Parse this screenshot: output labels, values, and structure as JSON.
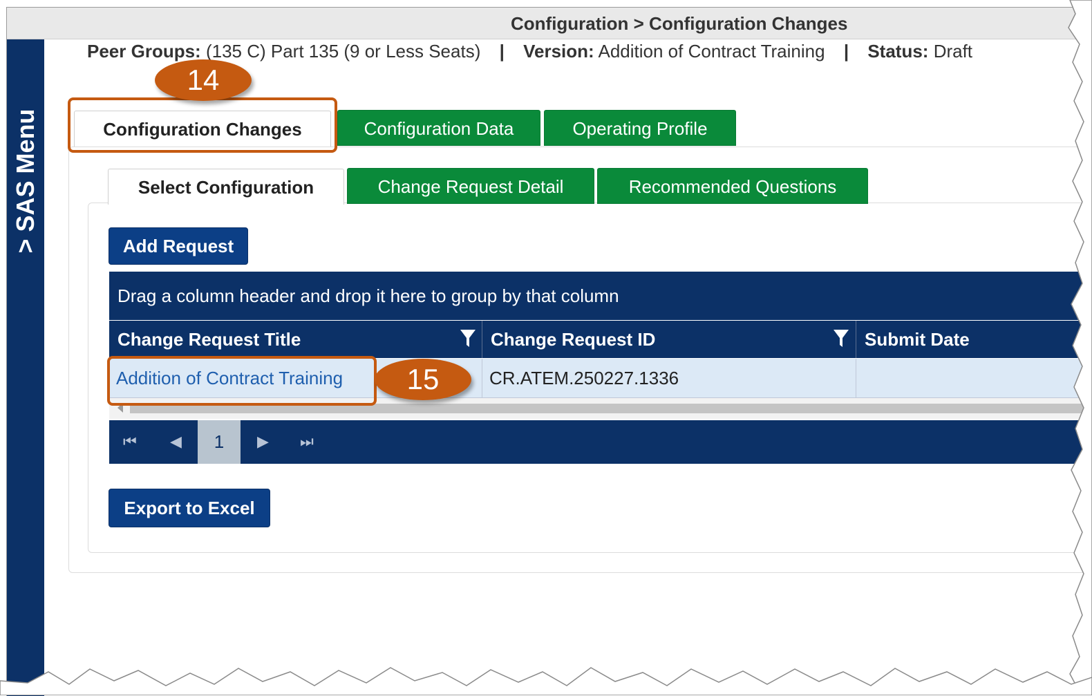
{
  "header": {
    "breadcrumb": "Configuration > Configuration Changes"
  },
  "sidebar": {
    "label": "> SAS Menu"
  },
  "info": {
    "peer_groups_label": "Peer Groups:",
    "peer_groups_value": "(135 C) Part 135 (9 or Less Seats)",
    "version_label": "Version:",
    "version_value": "Addition of Contract Training",
    "status_label": "Status:",
    "status_value": "Draft",
    "separator": "|"
  },
  "tabs": [
    {
      "label": "Configuration Changes",
      "active": true
    },
    {
      "label": "Configuration Data",
      "active": false
    },
    {
      "label": "Operating Profile",
      "active": false
    }
  ],
  "subtabs": [
    {
      "label": "Select Configuration",
      "active": true
    },
    {
      "label": "Change Request Detail",
      "active": false
    },
    {
      "label": "Recommended Questions",
      "active": false
    }
  ],
  "buttons": {
    "add_request": "Add Request",
    "export_excel": "Export to Excel"
  },
  "grid": {
    "group_hint": "Drag a column header and drop it here to group by that column",
    "columns": [
      "Change Request Title",
      "Change Request ID",
      "Submit Date"
    ],
    "rows": [
      {
        "title": "Addition of Contract Training",
        "id": "CR.ATEM.250227.1336",
        "submit_date": ""
      }
    ],
    "pager": {
      "current_page": "1"
    }
  },
  "callouts": [
    "14",
    "15"
  ],
  "colors": {
    "navy": "#0c3167",
    "green_tab": "#0a8a3a",
    "button_blue": "#0c3f86",
    "callout": "#c55a11",
    "row_bg": "#dce9f6",
    "link": "#1f5fae"
  }
}
